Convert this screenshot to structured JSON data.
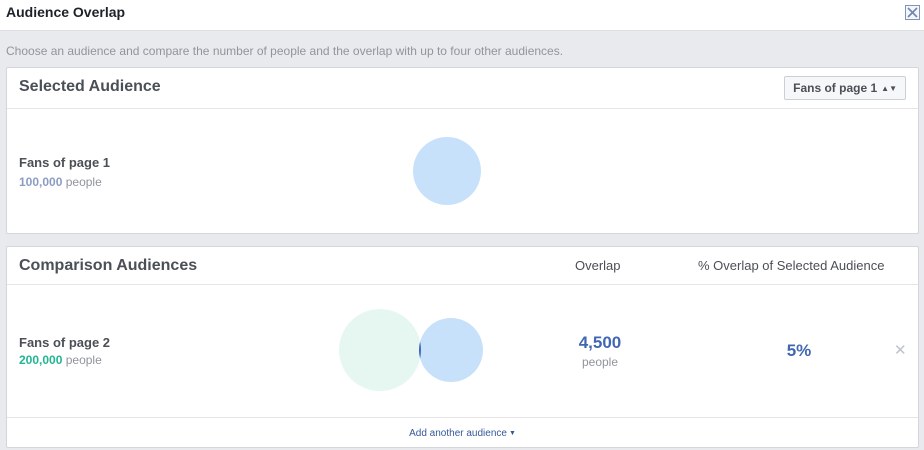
{
  "dialog": {
    "title": "Audience Overlap",
    "close_icon": "close-icon"
  },
  "intro": "Choose an audience and compare the number of people and the overlap with up to four other audiences.",
  "selected": {
    "title": "Selected Audience",
    "dropdown_value": "Fans of page 1",
    "audience": {
      "name": "Fans of page 1",
      "count": "100,000",
      "unit": "people"
    }
  },
  "comparison": {
    "title": "Comparison Audiences",
    "col_overlap": "Overlap",
    "col_pct": "% Overlap of Selected Audience",
    "rows": [
      {
        "name": "Fans of page 2",
        "count": "200,000",
        "unit": "people",
        "overlap": "4,500",
        "overlap_unit": "people",
        "pct": "5%"
      }
    ],
    "add_label": "Add another audience"
  },
  "colors": {
    "selected_circle": "#c7e1fb",
    "comparison_circle": "#e6f7f1",
    "overlap_region": "#4267b2",
    "accent_blue": "#4267b2",
    "accent_green": "#21b592"
  }
}
